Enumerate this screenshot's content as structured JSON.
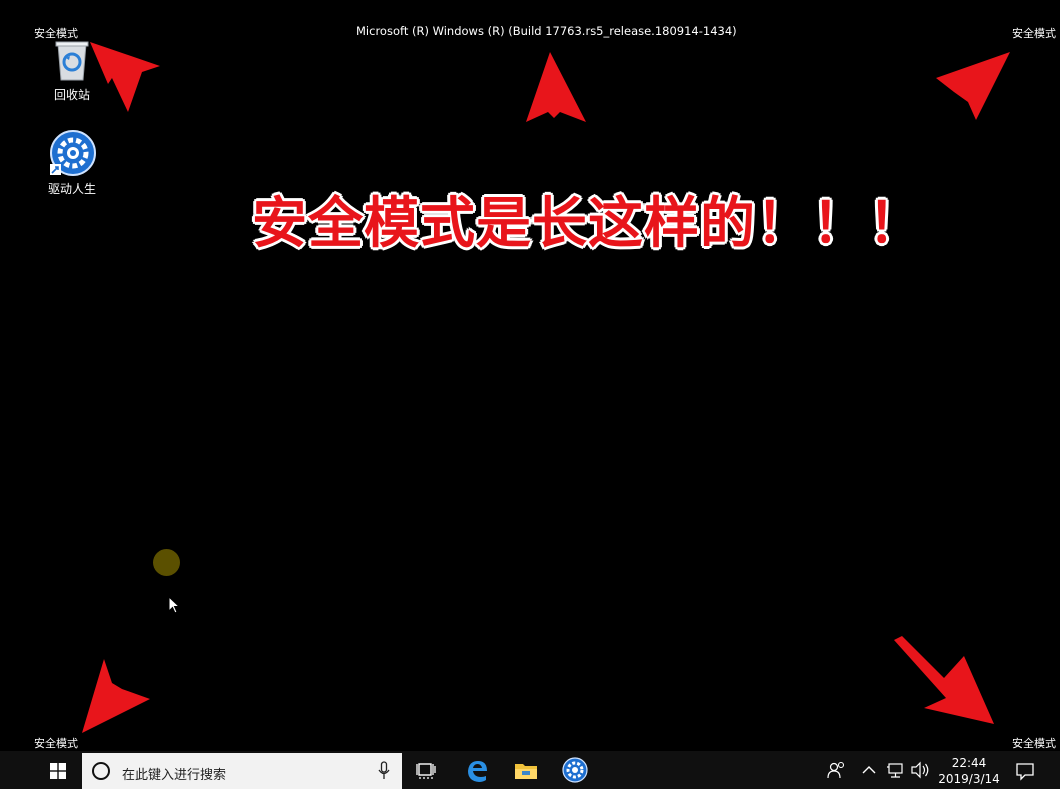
{
  "corners": {
    "top_left": "安全模式",
    "top_right": "安全模式",
    "bottom_left": "安全模式",
    "bottom_right": "安全模式"
  },
  "build": "Microsoft (R) Windows (R) (Build 17763.rs5_release.180914-1434)",
  "desktop_icons": [
    {
      "label": "回收站",
      "icon": "recycle-bin-icon"
    },
    {
      "label": "驱动人生",
      "icon": "driver-life-gear-icon"
    }
  ],
  "annotation": "安全模式是长这样的！！！",
  "colors": {
    "annotation": "#e8151b",
    "arrow": "#e8151b",
    "taskbar": "#101010"
  },
  "taskbar": {
    "search_placeholder": "在此键入进行搜索",
    "apps": [
      "task-view-icon",
      "edge-icon",
      "file-explorer-icon",
      "driver-life-icon"
    ],
    "time": "22:44",
    "date": "2019/3/14"
  }
}
